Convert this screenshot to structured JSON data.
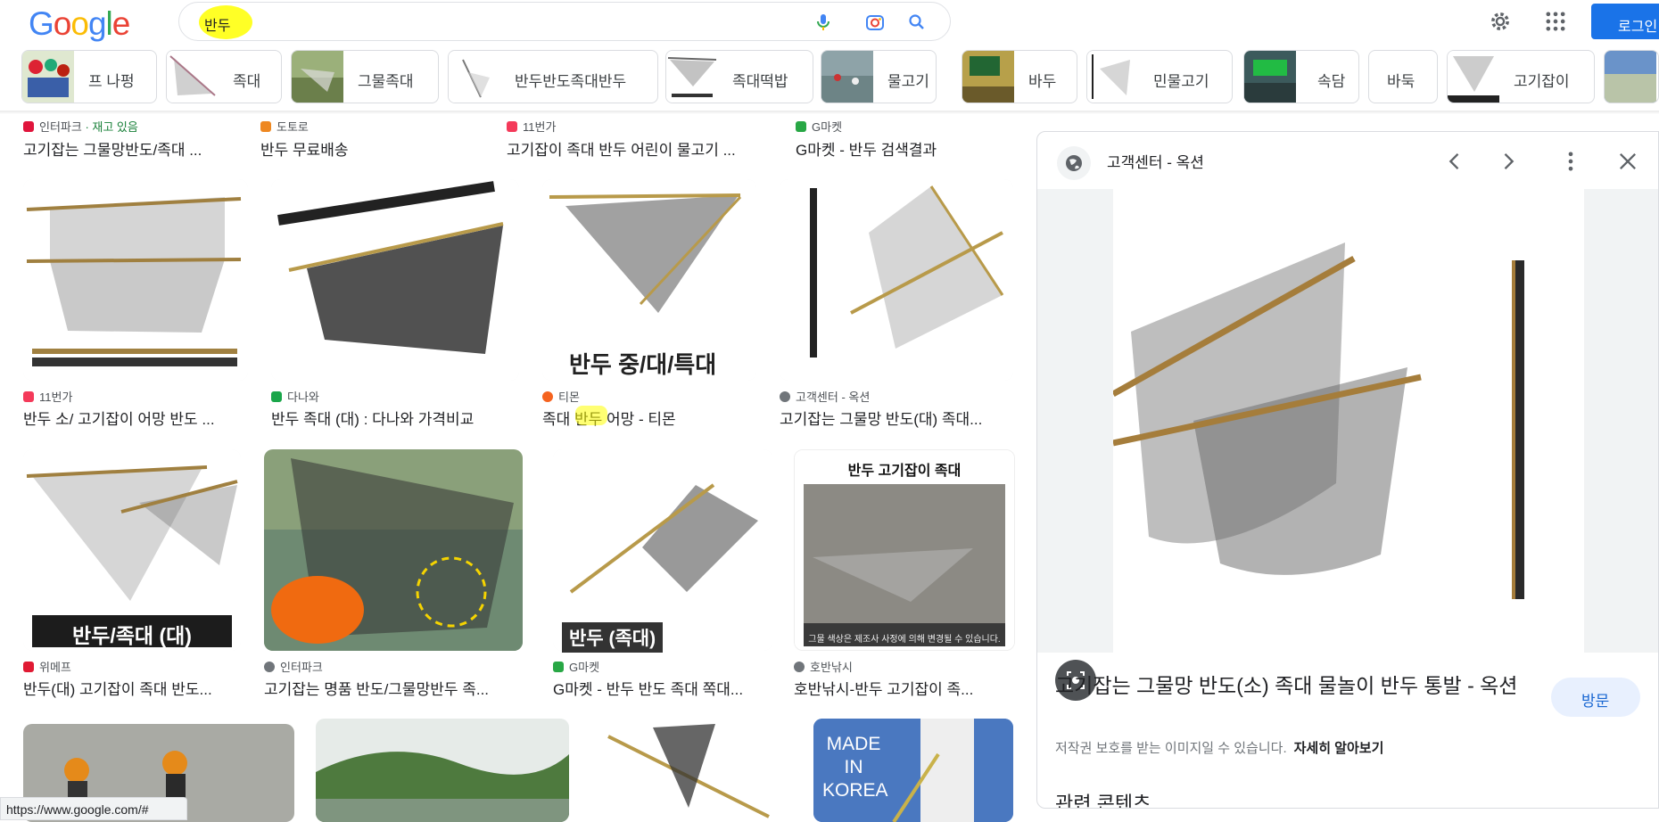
{
  "header": {
    "logo_letters": [
      "G",
      "o",
      "o",
      "g",
      "l",
      "e"
    ],
    "logo_colors": [
      "#4285F4",
      "#EA4335",
      "#FBBC05",
      "#4285F4",
      "#34A853",
      "#EA4335"
    ],
    "search_value": "반두",
    "login_label": "로그인"
  },
  "chips": [
    {
      "label": "프 나펑",
      "icon": "people-thumb"
    },
    {
      "label": "족대",
      "icon": "net-thumb"
    },
    {
      "label": "그물족대",
      "icon": "net-thumb"
    },
    {
      "label": "반두반도족대반두",
      "icon": "net-thumb"
    },
    {
      "label": "족대떡밥",
      "icon": "net-thumb"
    },
    {
      "label": "물고기",
      "icon": "river-thumb"
    },
    {
      "label": "바두",
      "icon": "sign-thumb"
    },
    {
      "label": "민물고기",
      "icon": "net-thumb"
    },
    {
      "label": "속담",
      "icon": "sign-thumb"
    },
    {
      "label": "바둑",
      "icon": ""
    },
    {
      "label": "고기잡이",
      "icon": "net-thumb"
    }
  ],
  "top_row": [
    {
      "source": "인터파크",
      "extra": " · 재고 있음",
      "title": "고기잡는 그물망반도/족대 ..."
    },
    {
      "source": "도토로",
      "extra": "",
      "title": "반두 무료배송"
    },
    {
      "source": "11번가",
      "extra": "",
      "title": "고기잡이 족대 반두 어린이 물고기 ..."
    },
    {
      "source": "G마켓",
      "extra": "",
      "title": "G마켓 - 반두 검색결과"
    }
  ],
  "row2": [
    {
      "source": "11번가",
      "title": "반두 소/ 고기잡이 어망 반도 ...",
      "caption": ""
    },
    {
      "source": "다나와",
      "title": "반두 족대 (대) : 다나와 가격비교",
      "caption": ""
    },
    {
      "source": "티몬",
      "title": "족대 반두 어망 - 티몬",
      "caption": "반두 중/대/특대"
    },
    {
      "source": "고객센터 - 옥션",
      "title": "고기잡는 그물망 반도(대) 족대...",
      "caption": ""
    }
  ],
  "row3": [
    {
      "source": "위메프",
      "title": "반두(대) 고기잡이 족대 반도...",
      "caption": "반두/족대 (대)"
    },
    {
      "source": "인터파크",
      "title": "고기잡는 명품 반도/그물망반두 족...",
      "caption": ""
    },
    {
      "source": "G마켓",
      "title": "G마켓 - 반두 반도 족대 쪽대...",
      "caption": "반두 (족대)"
    },
    {
      "source": "호반낚시",
      "title": "호반낚시-반두 고기잡이 족...",
      "caption": "반두 고기잡이 족대",
      "note": "그물 색상은 제조사 사정에 의해 변경될 수 있습니다."
    }
  ],
  "row4": [
    {
      "caption": ""
    },
    {
      "caption": ""
    },
    {
      "caption": ""
    },
    {
      "caption": "MADE IN KOREA"
    }
  ],
  "panel": {
    "source": "고객센터 - 옥션",
    "title": "고기잡는 그물망 반도(소) 족대 물놀이 반두 통발 - 옥션",
    "visit_label": "방문",
    "notice": "저작권 보호를 받는 이미지일 수 있습니다.",
    "learn_more": "자세히 알아보기",
    "related": "관련 콘텐츠"
  },
  "status_url": "https://www.google.com/#"
}
